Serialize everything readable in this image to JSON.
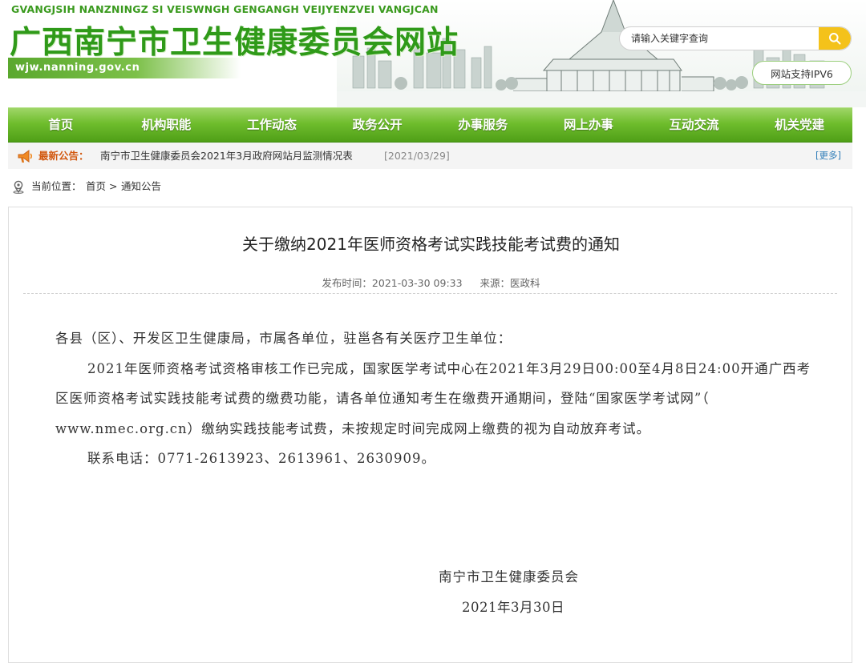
{
  "header": {
    "subtitle_pinyin": "GVANGJSIH NANZNINGZ SI VEISWNGH GENGANGH VEIJYENZVEI VANGJCAN",
    "site_title": "广西南宁市卫生健康委员会网站",
    "domain": "wjw.nanning.gov.cn",
    "search_placeholder": "请输入关键字查询",
    "search_icon": "search-icon",
    "ipv6_label": "网站支持IPV6",
    "brand_green": "#2f9a19"
  },
  "nav": {
    "items": [
      "首页",
      "机构职能",
      "工作动态",
      "政务公开",
      "办事服务",
      "网上办事",
      "互动交流",
      "机关党建"
    ]
  },
  "notice": {
    "label": "最新公告：",
    "text": "南宁市卫生健康委员会2021年3月政府网站月监测情况表",
    "date": "[2021/03/29]",
    "more": "[更多]",
    "icon": "megaphone-icon"
  },
  "breadcrumb": {
    "label": "当前位置：",
    "home": "首页",
    "separator": ">",
    "current": "通知公告",
    "icon": "location-pin-icon"
  },
  "article": {
    "title": "关于缴纳2021年医师资格考试实践技能考试费的通知",
    "publish_time": "发布时间：2021-03-30 09:33",
    "source": "来源：医政科",
    "greeting": "各县（区）、开发区卫生健康局，市属各单位，驻邕各有关医疗卫生单位：",
    "body": "2021年医师资格考试资格审核工作已完成，国家医学考试中心在2021年3月29日00:00至4月8日24:00开通广西考区医师资格考试实践技能考试费的缴费功能，请各单位通知考生在缴费开通期间，登陆“国家医学考试网”（ www.nmec.org.cn）缴纳实践技能考试费，未按规定时间完成网上缴费的视为自动放弃考试。",
    "contact": "联系电话：0771-2613923、2613961、2630909。",
    "signature_org": "南宁市卫生健康委员会",
    "signature_date": "2021年3月30日"
  }
}
